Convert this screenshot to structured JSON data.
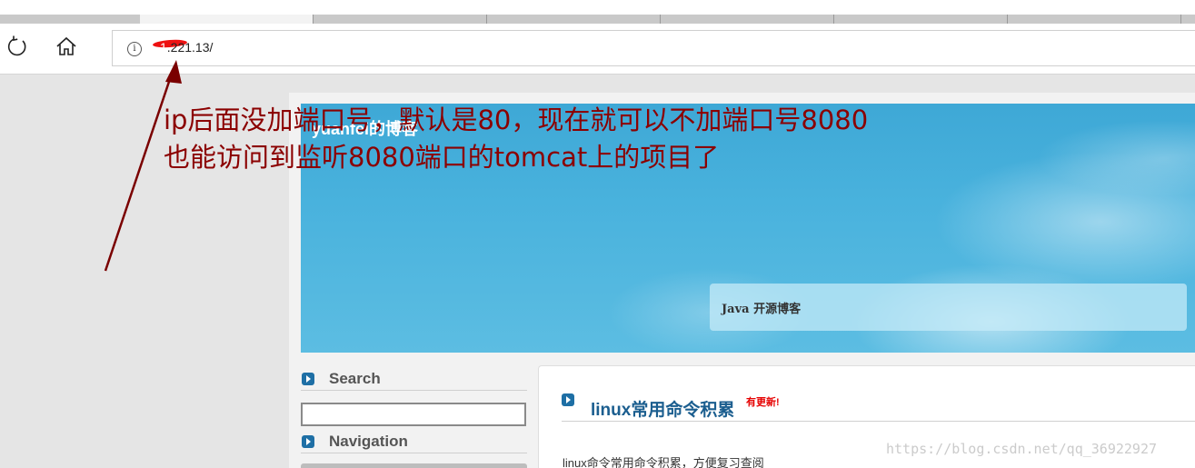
{
  "browser": {
    "address": ".221.13/",
    "address_prefix": "1"
  },
  "blog": {
    "title": "yuanfei的博客",
    "tagline": "Java 开源博客"
  },
  "sidebar": {
    "search_label": "Search",
    "search_value": "",
    "navigation_label": "Navigation"
  },
  "post": {
    "title": "linux常用命令积累",
    "badge": "有更新!",
    "summary": "linux命令常用命令积累，方便复习查阅"
  },
  "annotation": {
    "line1": "ip后面没加端口号，默认是80，现在就可以不加端口号8080",
    "line2": "也能访问到监听8080端口的tomcat上的项目了",
    "color": "#8b0000"
  },
  "watermark": "https://blog.csdn.net/qq_36922927",
  "colors": {
    "header_sky": "#49b2dd",
    "link_blue": "#1b5e8f",
    "badge_red": "#e60000",
    "bullet_blue": "#1e6fa5"
  }
}
